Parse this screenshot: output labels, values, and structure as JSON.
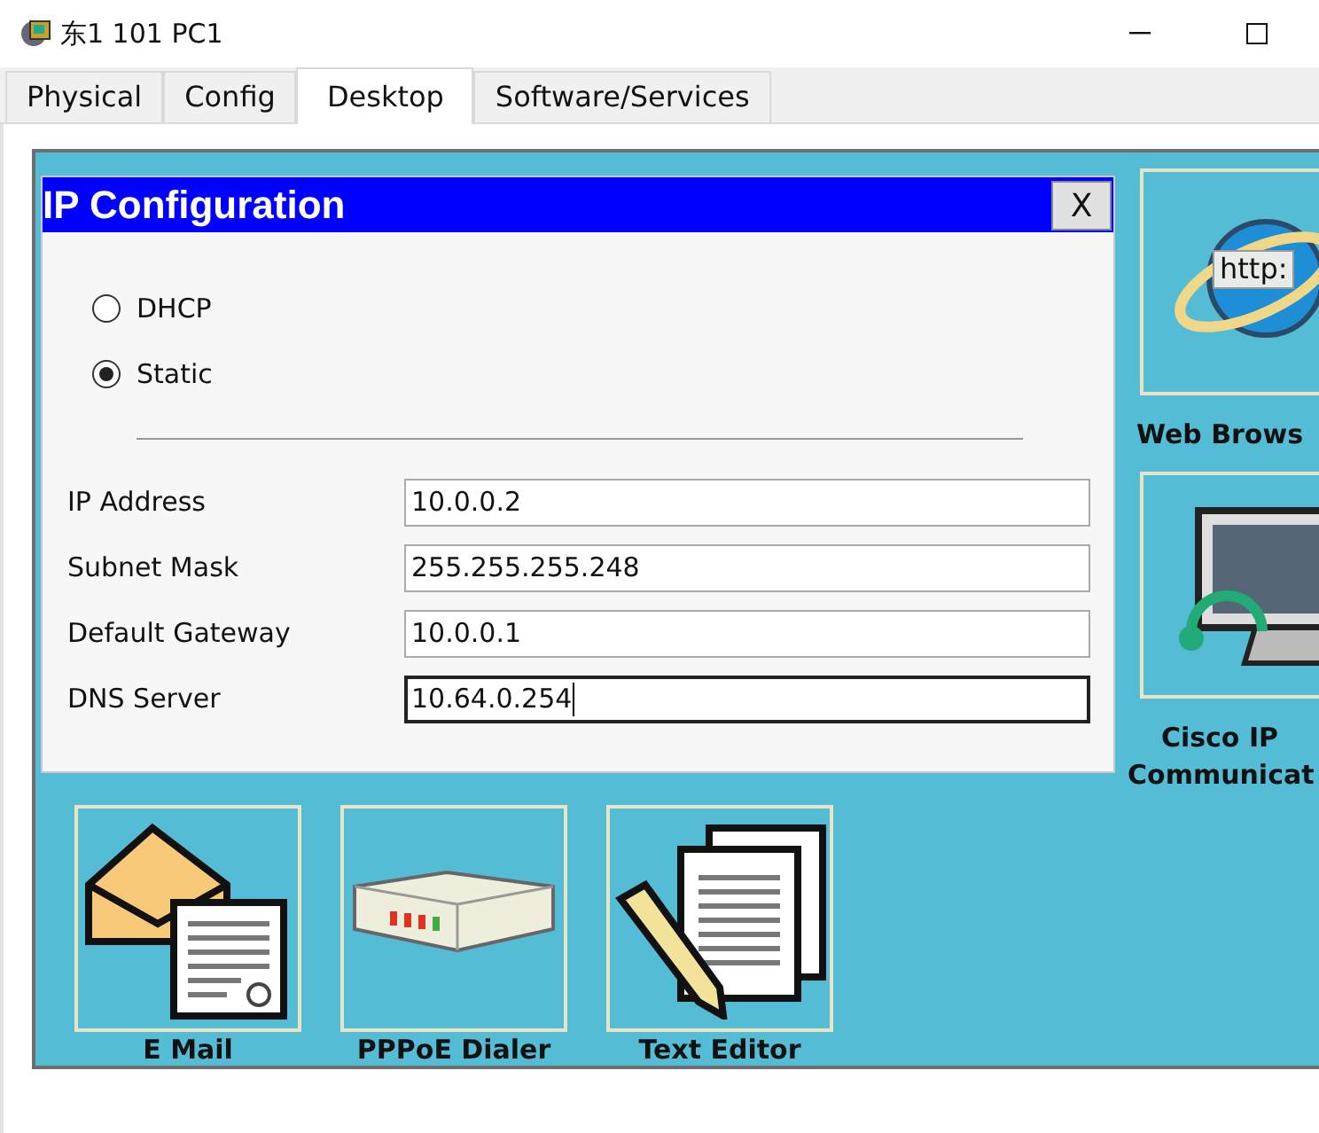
{
  "window": {
    "title": "东1 101 PC1"
  },
  "tabs": [
    {
      "label": "Physical",
      "selected": false
    },
    {
      "label": "Config",
      "selected": false
    },
    {
      "label": "Desktop",
      "selected": true
    },
    {
      "label": "Software/Services",
      "selected": false
    }
  ],
  "dialog": {
    "title": "IP Configuration",
    "close": "X",
    "modes": [
      {
        "label": "DHCP",
        "selected": false
      },
      {
        "label": "Static",
        "selected": true
      }
    ],
    "fields": [
      {
        "label": "IP Address",
        "value": "10.0.0.2",
        "focused": false
      },
      {
        "label": "Subnet Mask",
        "value": "255.255.255.248",
        "focused": false
      },
      {
        "label": "Default Gateway",
        "value": "10.0.0.1",
        "focused": false
      },
      {
        "label": "DNS Server",
        "value": "10.64.0.254",
        "focused": true
      }
    ]
  },
  "apps": [
    {
      "label": "E Mail",
      "kind": "email"
    },
    {
      "label": "PPPoE Dialer",
      "kind": "dialer"
    },
    {
      "label": "Text Editor",
      "kind": "editor"
    }
  ],
  "side_apps": [
    {
      "label": "Web Brows",
      "kind": "browser",
      "badge": "http:"
    },
    {
      "label": "Cisco IP Communicat",
      "kind": "phone"
    }
  ]
}
